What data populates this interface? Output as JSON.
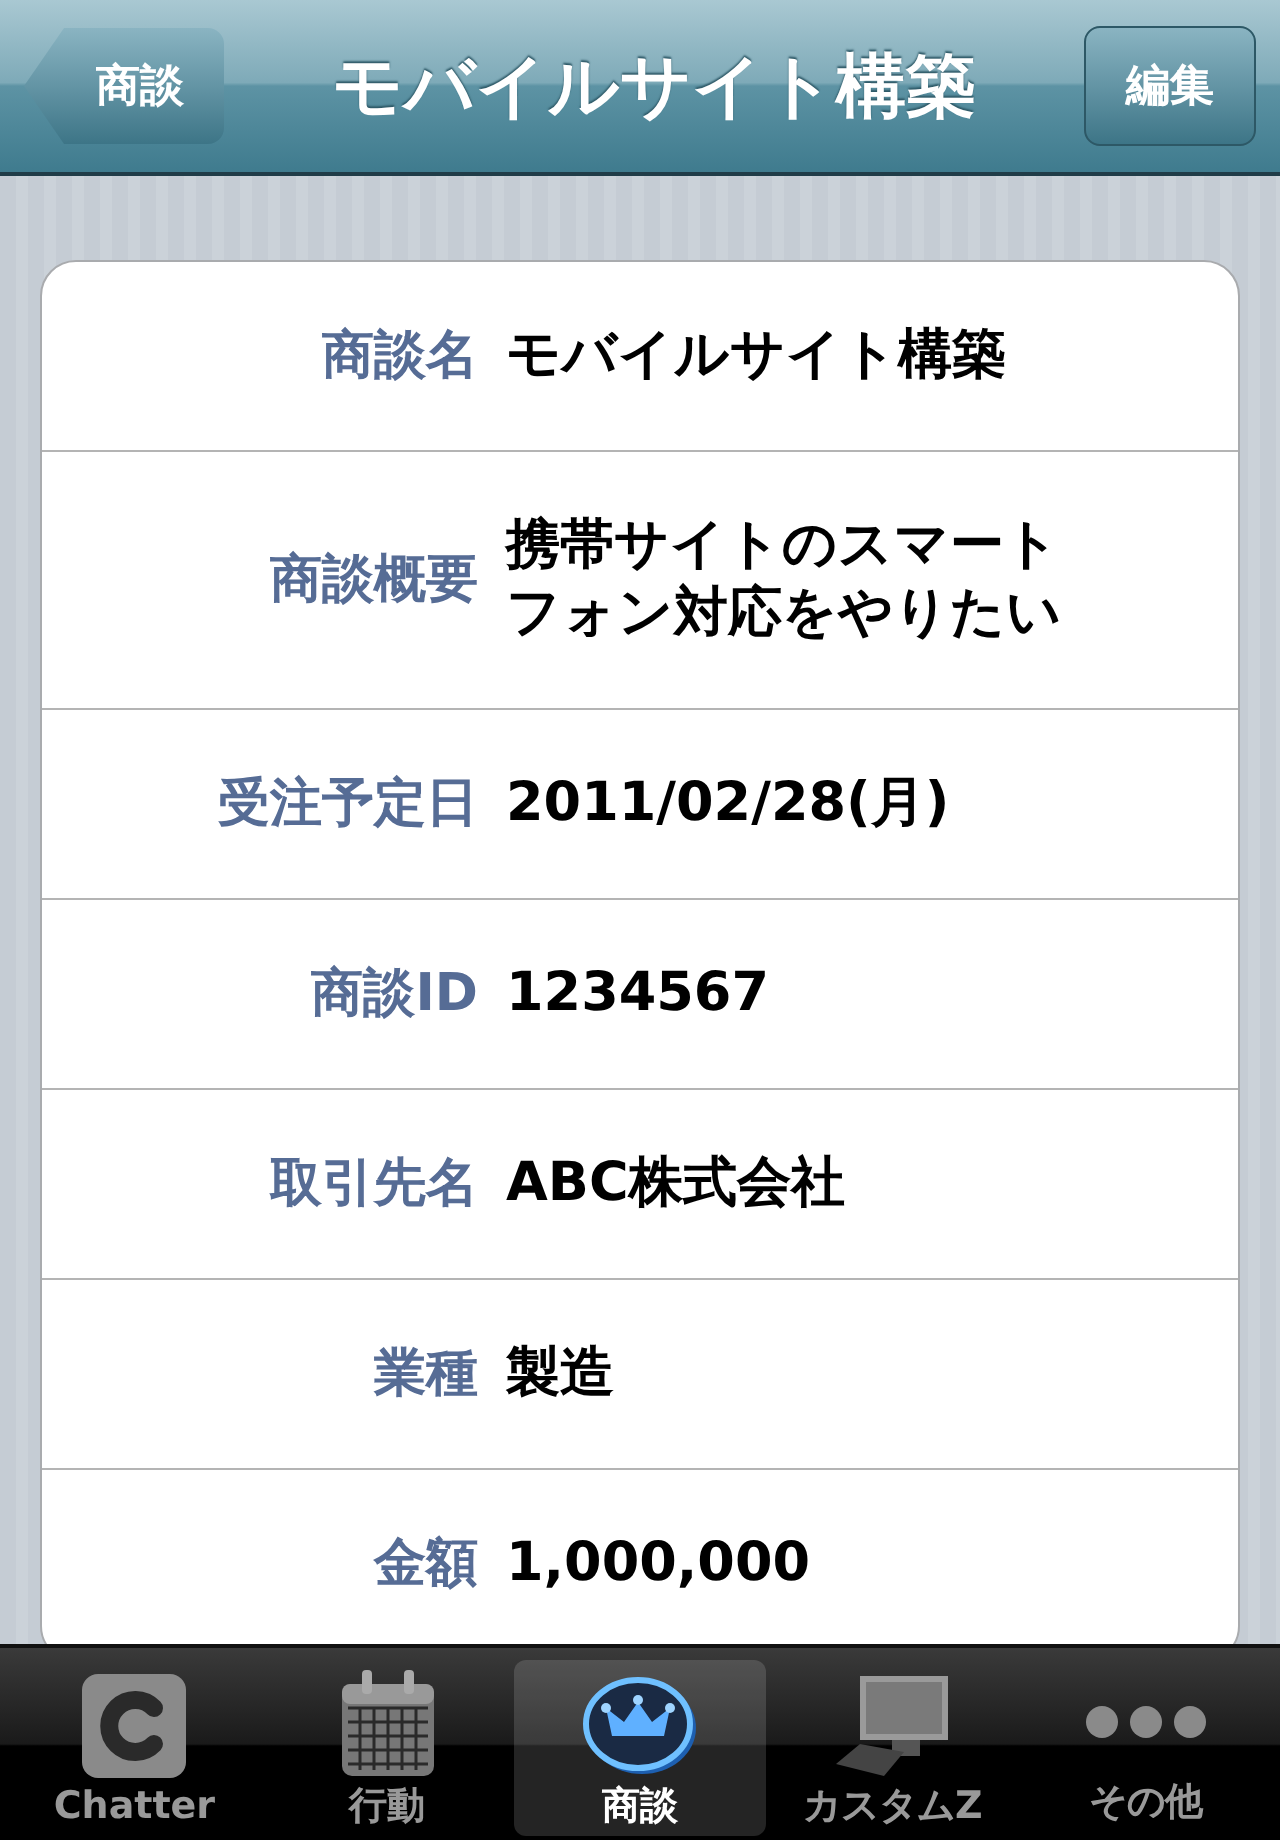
{
  "nav": {
    "back_button": "商談",
    "title": "モバイルサイト構築",
    "edit_button": "編集"
  },
  "fields": [
    {
      "label": "商談名",
      "value": "モバイルサイト構築"
    },
    {
      "label": "商談概要",
      "value": "携帯サイトのスマートフォン対応をやりたい"
    },
    {
      "label": "受注予定日",
      "value": "2011/02/28(月)"
    },
    {
      "label": "商談ID",
      "value": "1234567"
    },
    {
      "label": "取引先名",
      "value": "ABC株式会社"
    },
    {
      "label": "業種",
      "value": "製造"
    },
    {
      "label": "金額",
      "value": "1,000,000"
    }
  ],
  "tabs": [
    {
      "label": "Chatter",
      "selected": false
    },
    {
      "label": "行動",
      "selected": false
    },
    {
      "label": "商談",
      "selected": true
    },
    {
      "label": "カスタムZ",
      "selected": false
    },
    {
      "label": "その他",
      "selected": false
    }
  ]
}
